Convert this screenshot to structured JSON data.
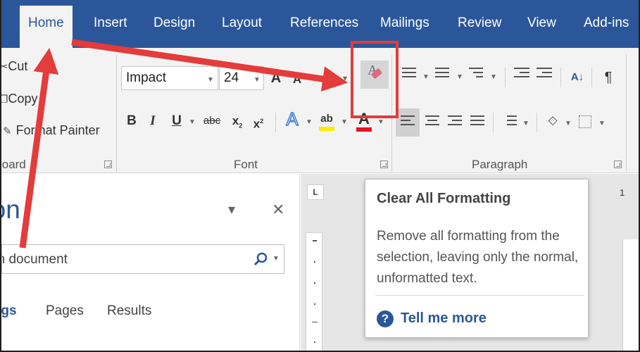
{
  "tabs": [
    "Home",
    "Insert",
    "Design",
    "Layout",
    "References",
    "Mailings",
    "Review",
    "View",
    "Add-ins"
  ],
  "clipboard": {
    "cut_label": "Cut",
    "copy_label": "Copy",
    "format_painter_label": "Format Painter",
    "group_label": "Clipboard"
  },
  "font": {
    "font_name": "Impact",
    "font_size": "24",
    "group_label": "Font",
    "bold": "B",
    "italic": "I",
    "underline": "U",
    "strikethrough": "abc",
    "subscript": "x",
    "superscript": "x",
    "text_effects": "A",
    "highlight": "ab",
    "font_color": "A",
    "grow": "A",
    "shrink": "A"
  },
  "paragraph": {
    "group_label": "Paragraph",
    "sort": "A↓",
    "pilcrow": "¶"
  },
  "navigation": {
    "title": "Navigation",
    "search_value": "Search document",
    "tabs": [
      "Headings",
      "Pages",
      "Results"
    ]
  },
  "ruler": {
    "corner_label": "L",
    "number": "1"
  },
  "tooltip": {
    "title": "Clear All Formatting",
    "body": "Remove all formatting from the selection, leaving only the normal, unformatted text.",
    "link": "Tell me more"
  },
  "colors": {
    "ribbon_blue": "#2b579a",
    "annotation_red": "#e43b3b",
    "highlight_yellow": "#ffeb00",
    "font_color_red": "#e81123"
  },
  "icons": [
    "cut-icon",
    "copy-icon",
    "format-painter-icon",
    "clear-formatting-icon",
    "search-icon",
    "close-icon",
    "chevron-down-icon",
    "help-icon"
  ]
}
